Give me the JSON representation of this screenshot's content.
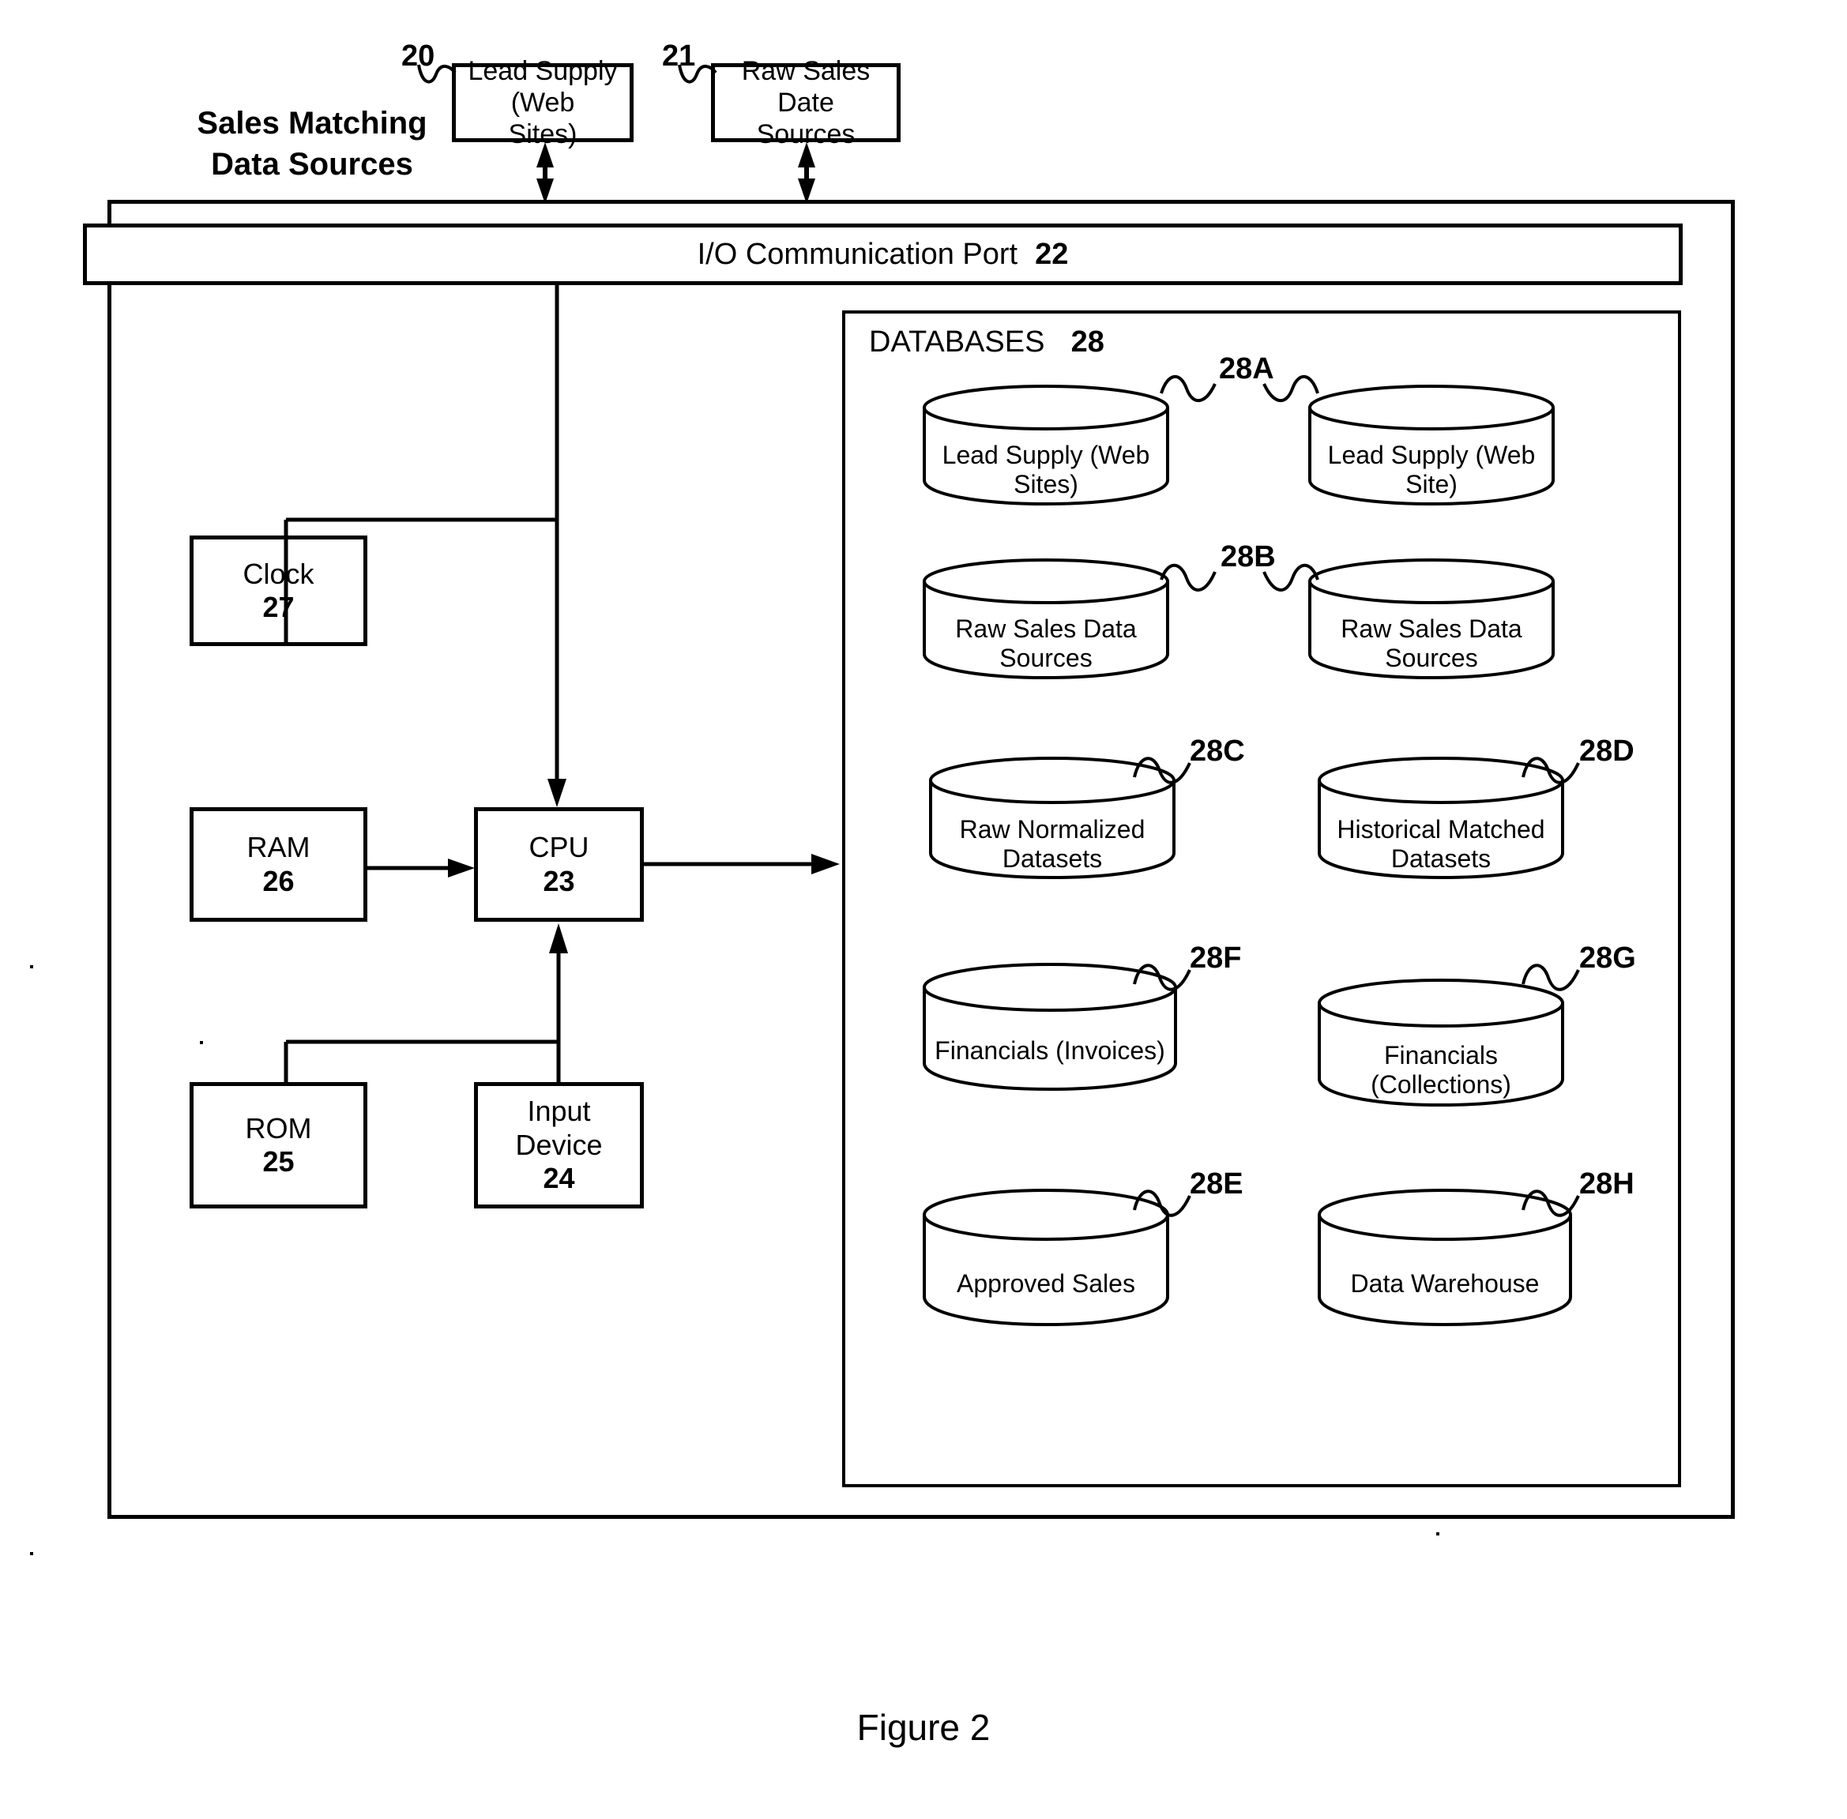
{
  "figure": {
    "caption": "Figure 2"
  },
  "title_block": {
    "text": "Sales Matching\nData Sources"
  },
  "external_sources": [
    {
      "ref": "20",
      "label": "Lead Supply (Web\nSites)"
    },
    {
      "ref": "21",
      "label": "Raw Sales Date\nSources"
    }
  ],
  "io_port": {
    "label": "I/O Communication Port",
    "ref": "22"
  },
  "components": [
    {
      "name": "clock",
      "label": "Clock",
      "ref": "27"
    },
    {
      "name": "ram",
      "label": "RAM",
      "ref": "26"
    },
    {
      "name": "cpu",
      "label": "CPU",
      "ref": "23"
    },
    {
      "name": "rom",
      "label": "ROM",
      "ref": "25"
    },
    {
      "name": "input-device",
      "label": "Input\nDevice",
      "ref": "24"
    }
  ],
  "databases": {
    "title": "DATABASES",
    "ref": "28",
    "items": [
      {
        "ref": "28A",
        "column": "left",
        "row": 1,
        "label": "Lead Supply (Web\nSites)"
      },
      {
        "ref": "28A",
        "column": "right",
        "row": 1,
        "label": "Lead Supply (Web\nSite)"
      },
      {
        "ref": "28B",
        "column": "left",
        "row": 2,
        "label": "Raw Sales Data\nSources"
      },
      {
        "ref": "28B",
        "column": "right",
        "row": 2,
        "label": "Raw Sales Data\nSources"
      },
      {
        "ref": "28C",
        "column": "left",
        "row": 3,
        "label": "Raw Normalized\nDatasets"
      },
      {
        "ref": "28D",
        "column": "right",
        "row": 3,
        "label": "Historical Matched\nDatasets"
      },
      {
        "ref": "28F",
        "column": "left",
        "row": 4,
        "label": "Financials (Invoices)"
      },
      {
        "ref": "28G",
        "column": "right",
        "row": 4,
        "label": "Financials\n(Collections)"
      },
      {
        "ref": "28E",
        "column": "left",
        "row": 5,
        "label": "Approved Sales"
      },
      {
        "ref": "28H",
        "column": "right",
        "row": 5,
        "label": "Data Warehouse"
      }
    ]
  },
  "colors": {
    "ink": "#000000",
    "paper": "#ffffff"
  }
}
